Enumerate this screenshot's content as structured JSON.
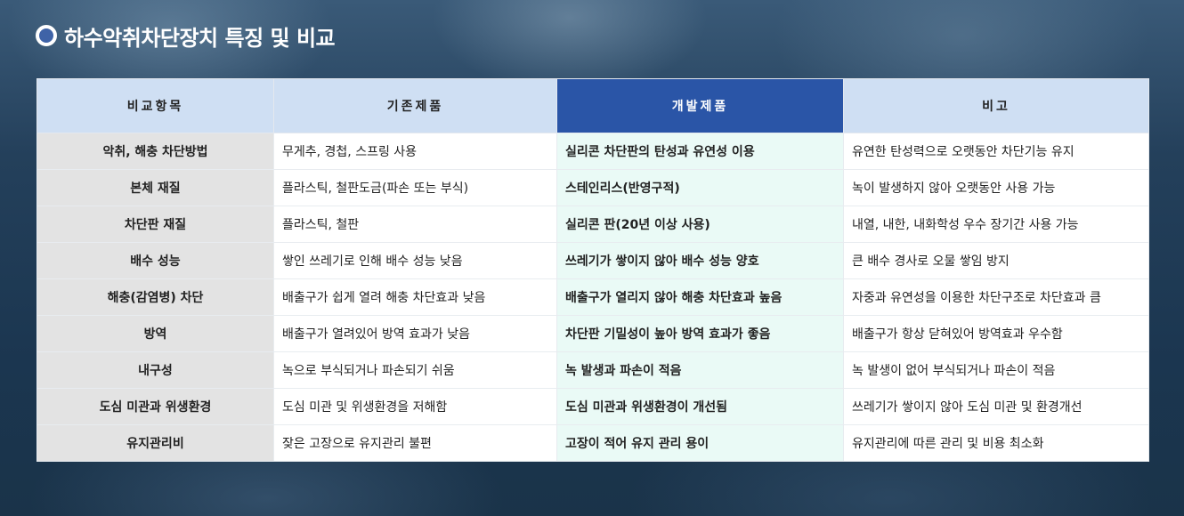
{
  "page": {
    "title": "하수악취차단장치 특징 및 비교"
  },
  "table": {
    "headers": [
      "비교항목",
      "기존제품",
      "개발제품",
      "비고"
    ],
    "rows": [
      {
        "item": "악취, 해충 차단방법",
        "existing": "무게추, 경첩, 스프링 사용",
        "developed": "실리콘 차단판의 탄성과 유연성 이용",
        "note": "유연한 탄성력으로 오랫동안 차단기능 유지"
      },
      {
        "item": "본체 재질",
        "existing": "플라스틱, 철판도금(파손 또는 부식)",
        "developed": "스테인리스(반영구적)",
        "note": "녹이 발생하지 않아 오랫동안 사용 가능"
      },
      {
        "item": "차단판 재질",
        "existing": "플라스틱, 철판",
        "developed": "실리콘 판(20년 이상 사용)",
        "note": "내열, 내한, 내화학성 우수 장기간 사용 가능"
      },
      {
        "item": "배수 성능",
        "existing": "쌓인 쓰레기로 인해 배수 성능 낮음",
        "developed": "쓰레기가 쌓이지 않아 배수 성능 양호",
        "note": "큰 배수 경사로 오물 쌓임 방지"
      },
      {
        "item": "해충(감염병) 차단",
        "existing": "배출구가 쉽게 열려 해충 차단효과 낮음",
        "developed": "배출구가 열리지 않아 해충 차단효과 높음",
        "note": "자중과 유연성을 이용한 차단구조로 차단효과 큼"
      },
      {
        "item": "방역",
        "existing": "배출구가 열려있어 방역 효과가 낮음",
        "developed": "차단판 기밀성이 높아 방역 효과가 좋음",
        "note": "배출구가 항상 닫혀있어 방역효과 우수함"
      },
      {
        "item": "내구성",
        "existing": "녹으로 부식되거나 파손되기 쉬움",
        "developed": "녹 발생과 파손이 적음",
        "note": "녹 발생이 없어 부식되거나 파손이 적음"
      },
      {
        "item": "도심 미관과 위생환경",
        "existing": "도심 미관 및 위생환경을 저해함",
        "developed": "도심 미관과 위생환경이 개선됨",
        "note": "쓰레기가 쌓이지 않아 도심 미관 및 환경개선"
      },
      {
        "item": "유지관리비",
        "existing": "잦은 고장으로 유지관리 불편",
        "developed": "고장이 적어 유지 관리 용이",
        "note": "유지관리에 따른 관리 및 비용 최소화"
      }
    ]
  },
  "colors": {
    "header_bg": "#cfdff3",
    "developed_header_bg": "#2a55a7",
    "item_col_bg": "#e3e3e3",
    "developed_col_bg": "#eafaf6",
    "page_bg": "#1d3a54"
  }
}
